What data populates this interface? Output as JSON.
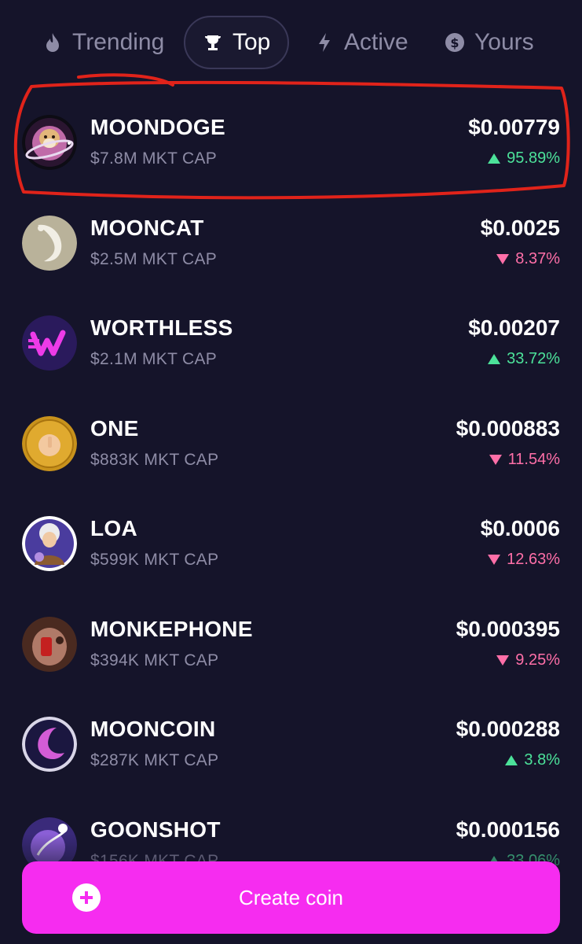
{
  "tabs": [
    {
      "label": "Trending",
      "icon": "flame-icon",
      "active": false
    },
    {
      "label": "Top",
      "icon": "trophy-icon",
      "active": true
    },
    {
      "label": "Active",
      "icon": "lightning-icon",
      "active": false
    },
    {
      "label": "Yours",
      "icon": "coins-icon",
      "active": false
    }
  ],
  "coins": [
    {
      "name": "MOONDOGE",
      "mkt_cap": "$7.8M MKT CAP",
      "price": "$0.00779",
      "change": "95.89%",
      "direction": "up",
      "avatar": "doge-planet-avatar"
    },
    {
      "name": "MOONCAT",
      "mkt_cap": "$2.5M MKT CAP",
      "price": "$0.0025",
      "change": "8.37%",
      "direction": "down",
      "avatar": "white-cat-avatar"
    },
    {
      "name": "WORTHLESS",
      "mkt_cap": "$2.1M MKT CAP",
      "price": "$0.00207",
      "change": "33.72%",
      "direction": "up",
      "avatar": "w-logo-avatar"
    },
    {
      "name": "ONE",
      "mkt_cap": "$883K MKT CAP",
      "price": "$0.000883",
      "change": "11.54%",
      "direction": "down",
      "avatar": "gold-coin-avatar"
    },
    {
      "name": "LOA",
      "mkt_cap": "$599K MKT CAP",
      "price": "$0.0006",
      "change": "12.63%",
      "direction": "down",
      "avatar": "einstein-avatar"
    },
    {
      "name": "MONKEPHONE",
      "mkt_cap": "$394K MKT CAP",
      "price": "$0.000395",
      "change": "9.25%",
      "direction": "down",
      "avatar": "monkey-phone-avatar"
    },
    {
      "name": "MOONCOIN",
      "mkt_cap": "$287K MKT CAP",
      "price": "$0.000288",
      "change": "3.8%",
      "direction": "up",
      "avatar": "crescent-moon-avatar"
    },
    {
      "name": "GOONSHOT",
      "mkt_cap": "$156K MKT CAP",
      "price": "$0.000156",
      "change": "33.06%",
      "direction": "up",
      "avatar": "purple-planet-avatar"
    }
  ],
  "create_button": {
    "label": "Create coin",
    "icon": "plus-circle-icon"
  },
  "colors": {
    "background": "#15142a",
    "accent": "#f62cf0",
    "up": "#4ce29a",
    "down": "#ff6fa8",
    "muted": "#8e8ca6",
    "highlight": "#e0231a"
  }
}
